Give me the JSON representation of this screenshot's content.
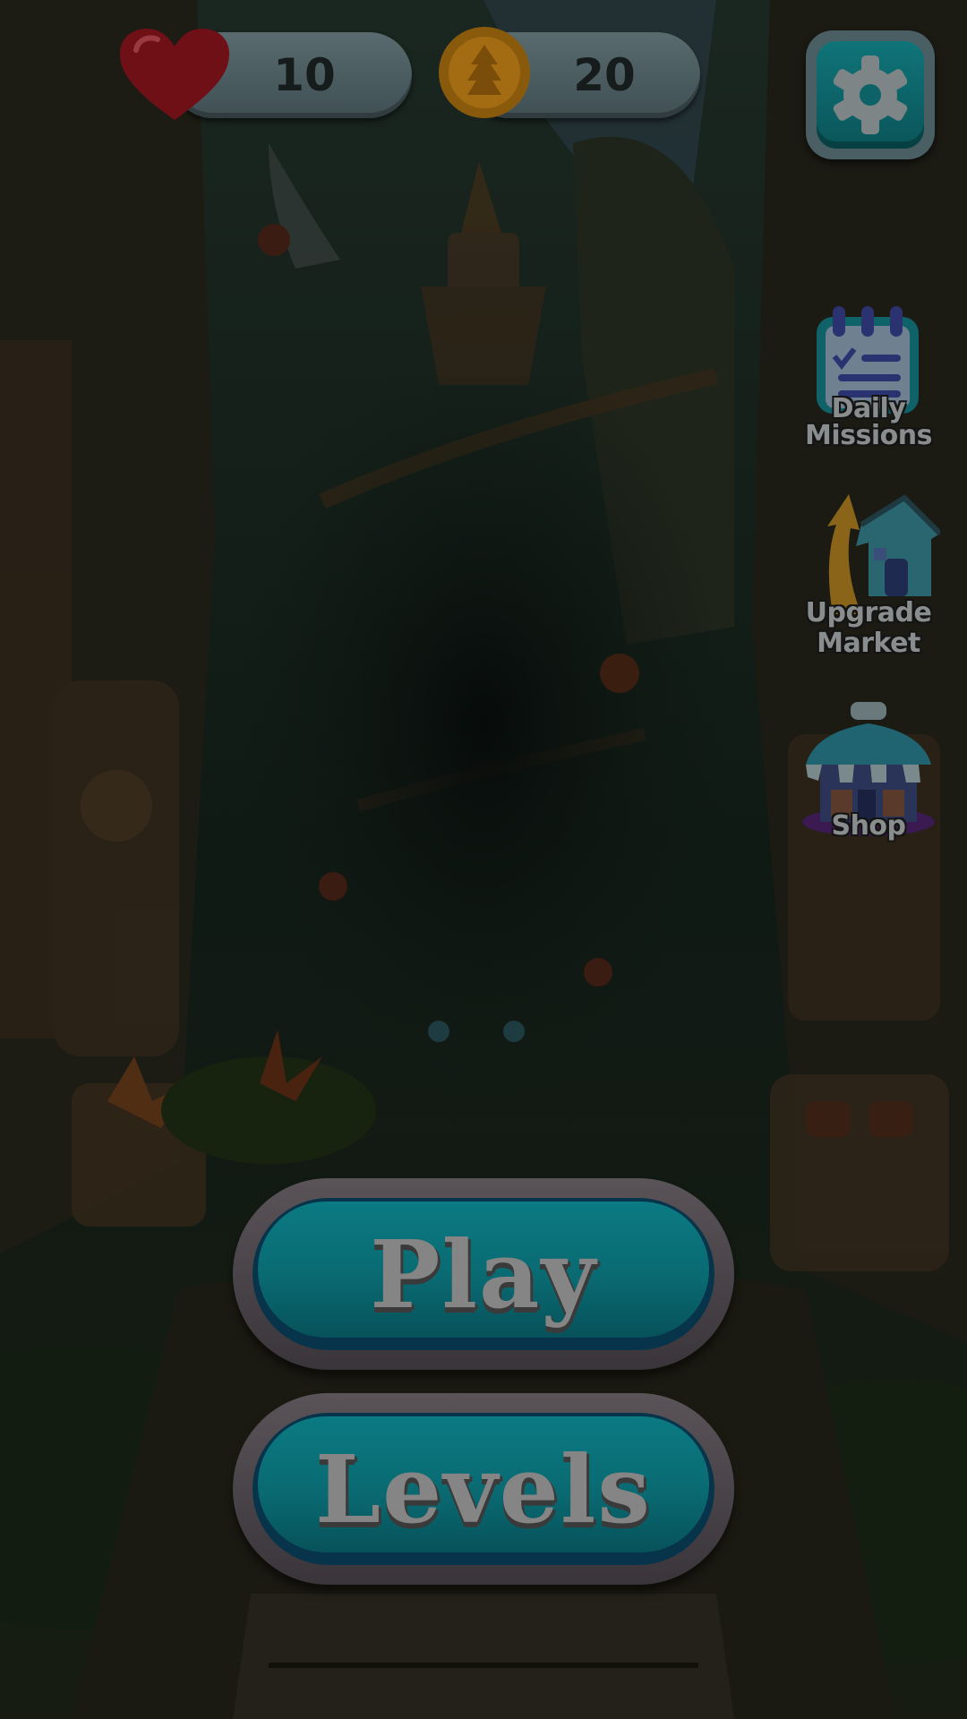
{
  "hud": {
    "lives": {
      "icon": "heart-icon",
      "value": "10"
    },
    "coins": {
      "icon": "coin-icon",
      "value": "20"
    },
    "settings": {
      "icon": "gear-icon"
    }
  },
  "side_menu": {
    "daily_missions": {
      "icon": "clipboard-icon",
      "label_line1": "Daily",
      "label_line2": "Missions"
    },
    "upgrade_market": {
      "icon": "upgrade-house-icon",
      "label_line1": "Upgrade",
      "label_line2": "Market"
    },
    "shop": {
      "icon": "shop-icon",
      "label": "Shop"
    }
  },
  "main_buttons": {
    "play_label": "Play",
    "levels_label": "Levels"
  },
  "colors": {
    "button_teal": "#0a6a72",
    "button_rim": "#5a5459",
    "heart": "#7a1018",
    "coin": "#a86e10",
    "label_gray": "#8a8d8e"
  }
}
